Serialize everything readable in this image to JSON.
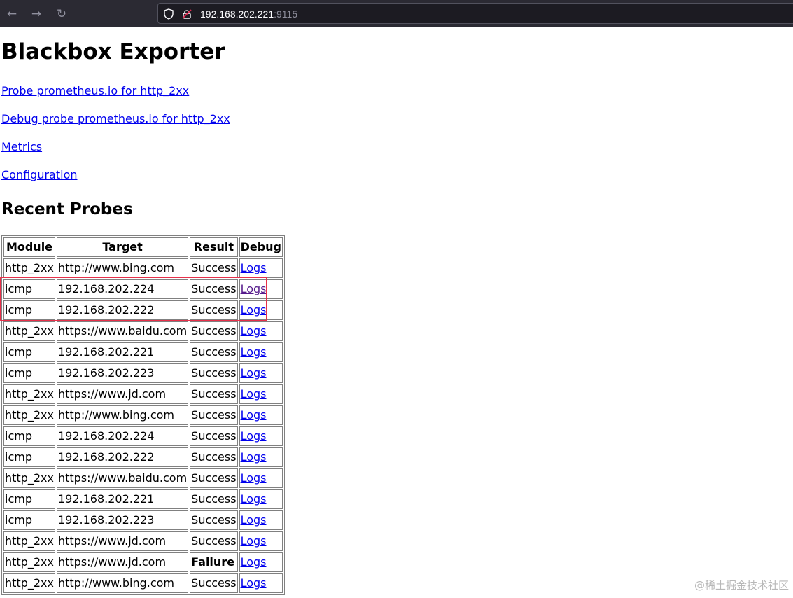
{
  "browser": {
    "url_host": "192.168.202.221",
    "url_port": ":9115",
    "back_icon": "arrow-left-icon",
    "forward_icon": "arrow-right-icon",
    "reload_icon": "reload-icon",
    "shield_icon": "tracking-protection-shield-icon",
    "insecure_icon": "insecure-lock-icon"
  },
  "page": {
    "title": "Blackbox Exporter",
    "links": [
      "Probe prometheus.io for http_2xx",
      "Debug probe prometheus.io for http_2xx",
      "Metrics",
      "Configuration"
    ],
    "section_title": "Recent Probes"
  },
  "table": {
    "headers": [
      "Module",
      "Target",
      "Result",
      "Debug"
    ],
    "rows": [
      {
        "module": "http_2xx",
        "target": "http://www.bing.com",
        "result": "Success",
        "debug": "Logs"
      },
      {
        "module": "icmp",
        "target": "192.168.202.224",
        "result": "Success",
        "debug": "Logs"
      },
      {
        "module": "icmp",
        "target": "192.168.202.222",
        "result": "Success",
        "debug": "Logs"
      },
      {
        "module": "http_2xx",
        "target": "https://www.baidu.com",
        "result": "Success",
        "debug": "Logs"
      },
      {
        "module": "icmp",
        "target": "192.168.202.221",
        "result": "Success",
        "debug": "Logs"
      },
      {
        "module": "icmp",
        "target": "192.168.202.223",
        "result": "Success",
        "debug": "Logs"
      },
      {
        "module": "http_2xx",
        "target": "https://www.jd.com",
        "result": "Success",
        "debug": "Logs"
      },
      {
        "module": "http_2xx",
        "target": "http://www.bing.com",
        "result": "Success",
        "debug": "Logs"
      },
      {
        "module": "icmp",
        "target": "192.168.202.224",
        "result": "Success",
        "debug": "Logs"
      },
      {
        "module": "icmp",
        "target": "192.168.202.222",
        "result": "Success",
        "debug": "Logs"
      },
      {
        "module": "http_2xx",
        "target": "https://www.baidu.com",
        "result": "Success",
        "debug": "Logs"
      },
      {
        "module": "icmp",
        "target": "192.168.202.221",
        "result": "Success",
        "debug": "Logs"
      },
      {
        "module": "icmp",
        "target": "192.168.202.223",
        "result": "Success",
        "debug": "Logs"
      },
      {
        "module": "http_2xx",
        "target": "https://www.jd.com",
        "result": "Success",
        "debug": "Logs"
      },
      {
        "module": "http_2xx",
        "target": "https://www.jd.com",
        "result": "Failure",
        "debug": "Logs"
      },
      {
        "module": "http_2xx",
        "target": "http://www.bing.com",
        "result": "Success",
        "debug": "Logs"
      }
    ]
  },
  "watermark": "@稀土掘金技术社区",
  "colors": {
    "link": "#0000ee",
    "visited_link": "#551a8b",
    "highlight": "#e8304a",
    "toolbar_bg": "#2b2a33"
  }
}
